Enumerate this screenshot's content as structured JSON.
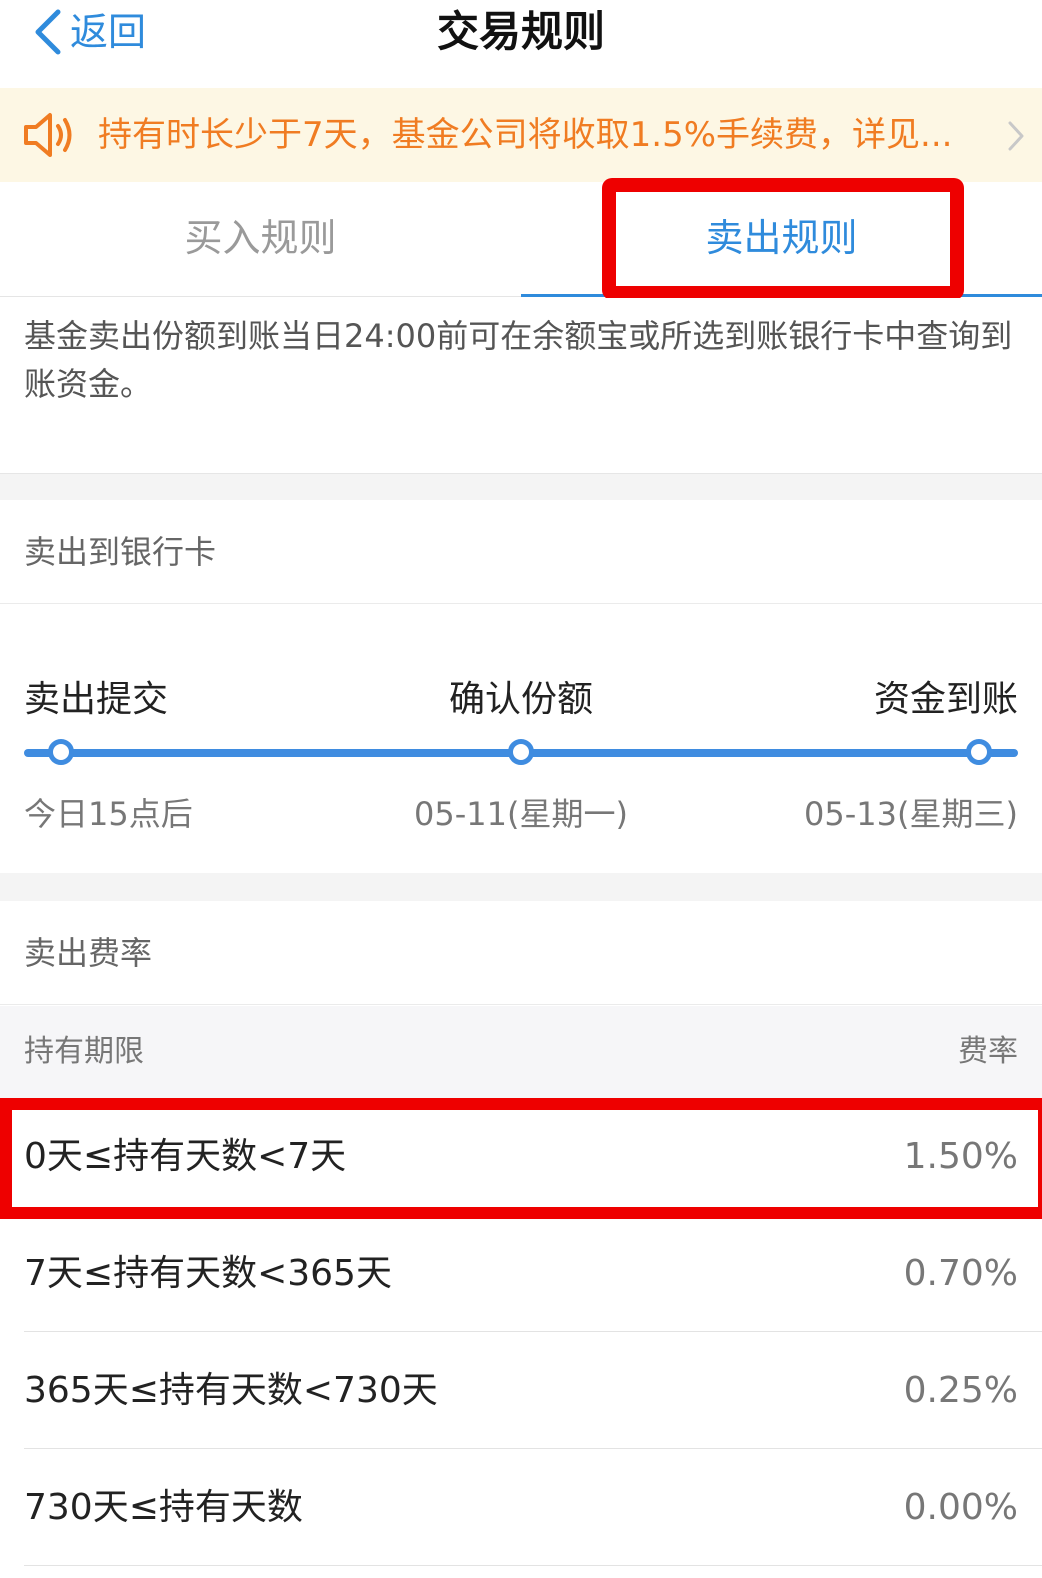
{
  "nav": {
    "back_label": "返回",
    "title": "交易规则"
  },
  "notice": {
    "text": "持有时长少于7天，基金公司将收取1.5%手续费，详见..."
  },
  "tabs": {
    "buy_label": "买入规则",
    "sell_label": "卖出规则",
    "active": "卖出规则"
  },
  "description": "基金卖出份额到账当日24:00前可在余额宝或所选到账银行卡中查询到账资金。",
  "bank_section": {
    "title": "卖出到银行卡",
    "steps": [
      {
        "label": "卖出提交",
        "date": "今日15点后"
      },
      {
        "label": "确认份额",
        "date": "05-11(星期一)"
      },
      {
        "label": "资金到账",
        "date": "05-13(星期三)"
      }
    ]
  },
  "fee_section": {
    "title": "卖出费率",
    "header_period": "持有期限",
    "header_rate": "费率",
    "rows": [
      {
        "period": "0天≤持有天数<7天",
        "rate": "1.50%"
      },
      {
        "period": "7天≤持有天数<365天",
        "rate": "0.70%"
      },
      {
        "period": "365天≤持有天数<730天",
        "rate": "0.25%"
      },
      {
        "period": "730天≤持有天数",
        "rate": "0.00%"
      }
    ]
  },
  "colors": {
    "accent": "#2f8bdc",
    "notice_text": "#f07c22",
    "notice_bg": "#fdf7e4",
    "annotation": "#ee0000"
  }
}
